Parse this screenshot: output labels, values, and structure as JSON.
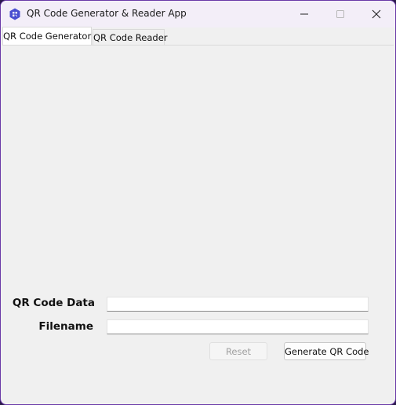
{
  "window": {
    "title": "QR Code Generator & Reader App",
    "app_icon": "qr-app-icon",
    "controls": [
      "minimize-icon",
      "maximize-icon",
      "close-icon"
    ]
  },
  "tabs": [
    {
      "label": "QR Code Generator",
      "active": true
    },
    {
      "label": "QR Code Reader",
      "active": false
    }
  ],
  "form": {
    "qr_data_label": "QR Code Data",
    "qr_data_value": "",
    "filename_label": "Filename",
    "filename_value": ""
  },
  "buttons": {
    "reset_label": "Reset",
    "reset_enabled": false,
    "generate_label": "Generate QR Code"
  },
  "colors": {
    "window_border": "#6a3aa8",
    "titlebar_bg": "#f3eef8",
    "content_bg": "#f0f0f0",
    "app_icon_bg": "#4a4fd0"
  }
}
